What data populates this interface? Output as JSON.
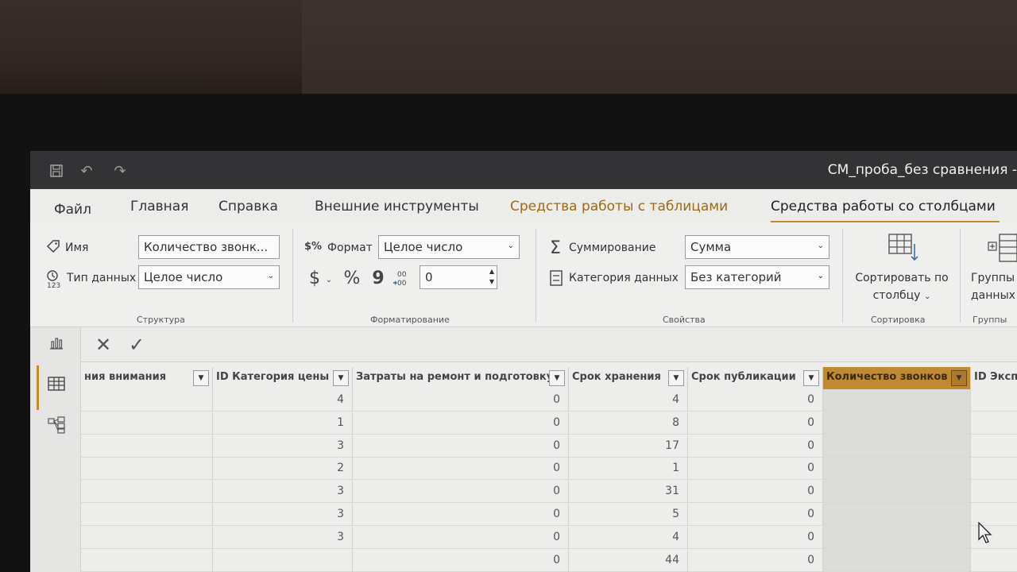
{
  "window": {
    "title": "СМ_проба_без сравнения -"
  },
  "tabs": [
    {
      "label": "Файл"
    },
    {
      "label": "Главная"
    },
    {
      "label": "Справка"
    },
    {
      "label": "Внешние инструменты"
    },
    {
      "label": "Средства работы с таблицами"
    },
    {
      "label": "Средства работы со столбцами"
    }
  ],
  "ribbon": {
    "structure": {
      "name_label": "Имя",
      "name_value": "Количество звонк...",
      "type_label": "Тип данных",
      "type_value": "Целое число",
      "group_label": "Структура"
    },
    "formatting": {
      "format_label": "Формат",
      "format_value": "Целое число",
      "currency_symbol": "$",
      "percent_symbol": "%",
      "comma_symbol": "9",
      "decimals_value": "0",
      "group_label": "Форматирование"
    },
    "properties": {
      "sum_label": "Суммирование",
      "sum_value": "Сумма",
      "category_label": "Категория данных",
      "category_value": "Без категорий",
      "group_label": "Свойства"
    },
    "sort": {
      "button_line1": "Сортировать по",
      "button_line2": "столбцу",
      "group_label": "Сортировка"
    },
    "groups": {
      "button_line1": "Группы",
      "button_line2": "данных",
      "group_label": "Группы"
    }
  },
  "table": {
    "columns": [
      "ния внимания",
      "ID Категория цены",
      "Затраты на ремонт и подготовку",
      "Срок хранения",
      "Срок публикации",
      "Количество звонков",
      "ID Экспозиции"
    ],
    "rows": [
      [
        "",
        "4",
        "0",
        "4",
        "0",
        "",
        ""
      ],
      [
        "",
        "1",
        "0",
        "8",
        "0",
        "",
        ""
      ],
      [
        "",
        "3",
        "0",
        "17",
        "0",
        "",
        ""
      ],
      [
        "",
        "2",
        "0",
        "1",
        "0",
        "",
        ""
      ],
      [
        "",
        "3",
        "0",
        "31",
        "0",
        "",
        ""
      ],
      [
        "",
        "3",
        "0",
        "5",
        "0",
        "",
        ""
      ],
      [
        "",
        "3",
        "0",
        "4",
        "0",
        "",
        ""
      ],
      [
        "",
        "",
        "0",
        "44",
        "0",
        "",
        ""
      ]
    ],
    "selected_column": "Количество звонков"
  },
  "colors": {
    "accent": "#c08a32",
    "titlebar": "#333335"
  }
}
